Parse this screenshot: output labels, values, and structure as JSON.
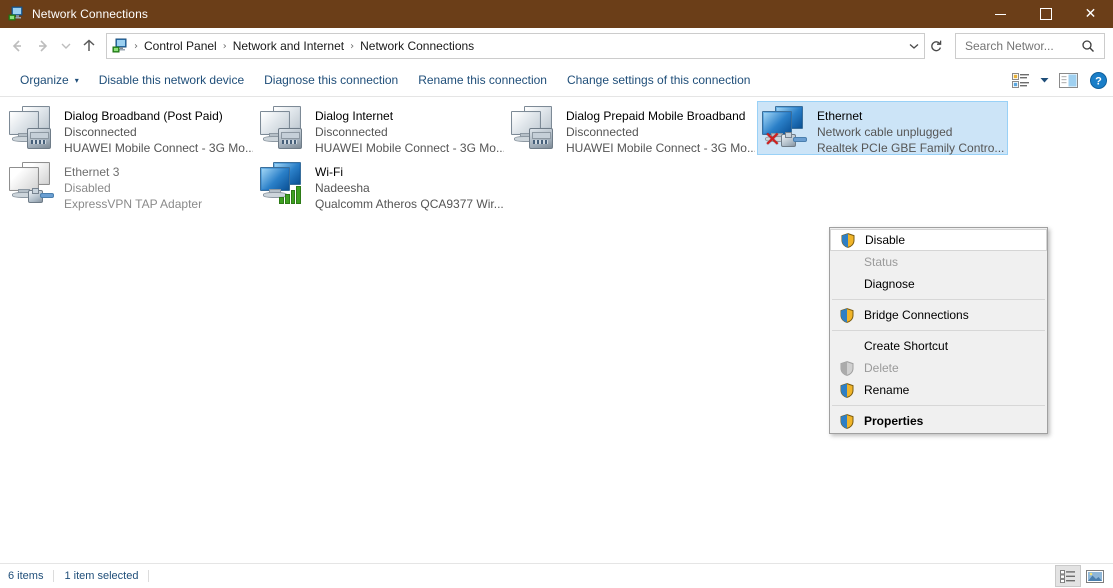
{
  "window": {
    "title": "Network Connections",
    "icon": "network-connections-icon",
    "controls": {
      "minimize": "—",
      "maximize": "□",
      "close": "✕"
    }
  },
  "address": {
    "back_icon": "back-arrow-icon",
    "forward_icon": "forward-arrow-icon",
    "recent_icon": "chevron-down-icon",
    "up_icon": "up-arrow-icon",
    "path_icon": "control-panel-icon",
    "crumbs": [
      "Control Panel",
      "Network and Internet",
      "Network Connections"
    ],
    "separator": "❯",
    "dropdown_icon": "chevron-down-icon",
    "refresh_icon": "refresh-icon",
    "refresh_glyph": "↻"
  },
  "search": {
    "value": "",
    "placeholder": "Search Networ...",
    "icon": "search-icon",
    "glyph": "⌕"
  },
  "toolbar": {
    "organize": "Organize",
    "organize_caret": "▾",
    "disable_device": "Disable this network device",
    "diagnose": "Diagnose this connection",
    "rename": "Rename this connection",
    "change_settings": "Change settings of this connection",
    "view_icon": "change-view-icon",
    "view_caret": "▾",
    "preview_pane_icon": "preview-pane-icon",
    "help_icon": "help-icon",
    "help_glyph": "?"
  },
  "connections": [
    {
      "name": "Dialog Broadband (Post Paid)",
      "status": "Disconnected",
      "device": "HUAWEI Mobile Connect - 3G Mo...",
      "icon": "modem-connection-icon",
      "state": "disconnected",
      "selected": false
    },
    {
      "name": "Dialog Internet",
      "status": "Disconnected",
      "device": "HUAWEI Mobile Connect - 3G Mo...",
      "icon": "modem-connection-icon",
      "state": "disconnected",
      "selected": false
    },
    {
      "name": "Dialog Prepaid Mobile Broadband",
      "status": "Disconnected",
      "device": "HUAWEI Mobile Connect - 3G Mo...",
      "icon": "modem-connection-icon",
      "state": "disconnected",
      "selected": false
    },
    {
      "name": "Ethernet",
      "status": "Network cable unplugged",
      "device": "Realtek PCIe GBE Family Contro...",
      "icon": "ethernet-unplugged-icon",
      "state": "unplugged",
      "selected": true
    },
    {
      "name": "Ethernet 3",
      "status": "Disabled",
      "device": "ExpressVPN TAP Adapter",
      "icon": "ethernet-disabled-icon",
      "state": "disabled",
      "selected": false
    },
    {
      "name": "Wi-Fi",
      "status": "Nadeesha",
      "device": "Qualcomm Atheros QCA9377 Wir...",
      "icon": "wifi-connected-icon",
      "state": "connected",
      "selected": false
    }
  ],
  "context_menu": {
    "items": [
      {
        "label": "Disable",
        "shield": true,
        "disabled": false,
        "bold": false,
        "hover": true,
        "sep_after": false
      },
      {
        "label": "Status",
        "shield": false,
        "disabled": true,
        "bold": false,
        "hover": false,
        "sep_after": false
      },
      {
        "label": "Diagnose",
        "shield": false,
        "disabled": false,
        "bold": false,
        "hover": false,
        "sep_after": true
      },
      {
        "label": "Bridge Connections",
        "shield": true,
        "disabled": false,
        "bold": false,
        "hover": false,
        "sep_after": true
      },
      {
        "label": "Create Shortcut",
        "shield": false,
        "disabled": false,
        "bold": false,
        "hover": false,
        "sep_after": false
      },
      {
        "label": "Delete",
        "shield": true,
        "disabled": true,
        "bold": false,
        "hover": false,
        "sep_after": false
      },
      {
        "label": "Rename",
        "shield": true,
        "disabled": false,
        "bold": false,
        "hover": false,
        "sep_after": true
      },
      {
        "label": "Properties",
        "shield": true,
        "disabled": false,
        "bold": true,
        "hover": false,
        "sep_after": false
      }
    ]
  },
  "statusbar": {
    "item_count": "6 items",
    "selection": "1 item selected",
    "details_view_icon": "details-view-icon",
    "large-icons_view_icon": "large-icons-view-icon"
  },
  "colors": {
    "titlebar": "#6b3e18",
    "selection": "#cce4f7",
    "command_text": "#1f4e79",
    "menu_bg": "#f0f0f0"
  }
}
